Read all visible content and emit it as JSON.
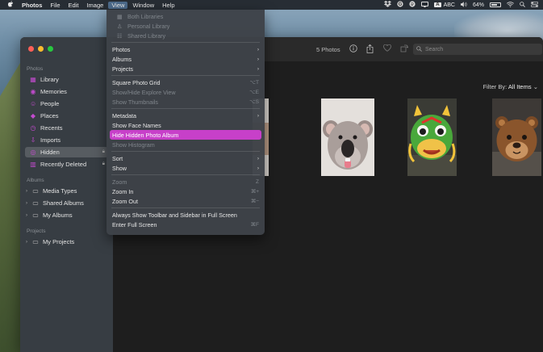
{
  "menubar": {
    "app_name": "Photos",
    "menus": [
      "File",
      "Edit",
      "Image",
      "View",
      "Window",
      "Help"
    ],
    "active_menu": "View",
    "status": {
      "input_source": "ABC",
      "battery": "64%"
    }
  },
  "view_menu": {
    "library_items": [
      {
        "label": "Both Libraries",
        "enabled": false
      },
      {
        "label": "Personal Library",
        "enabled": false
      },
      {
        "label": "Shared Library",
        "enabled": false
      }
    ],
    "group1": [
      {
        "label": "Photos",
        "submenu": true
      },
      {
        "label": "Albums",
        "submenu": true
      },
      {
        "label": "Projects",
        "submenu": true
      }
    ],
    "group2": [
      {
        "label": "Square Photo Grid",
        "shortcut": "⌥T",
        "enabled": true
      },
      {
        "label": "Show/Hide Explore View",
        "shortcut": "⌥E",
        "enabled": false
      },
      {
        "label": "Show Thumbnails",
        "shortcut": "⌥S",
        "enabled": false
      }
    ],
    "group3": [
      {
        "label": "Metadata",
        "submenu": true,
        "enabled": true
      },
      {
        "label": "Show Face Names",
        "enabled": true
      },
      {
        "label": "Hide Hidden Photo Album",
        "enabled": true,
        "highlighted": true
      },
      {
        "label": "Show Histogram",
        "enabled": false
      }
    ],
    "group4": [
      {
        "label": "Sort",
        "submenu": true
      },
      {
        "label": "Show",
        "submenu": true
      }
    ],
    "group5": [
      {
        "label": "Zoom",
        "shortcut": "Z",
        "enabled": false
      },
      {
        "label": "Zoom In",
        "shortcut": "⌘+",
        "enabled": true
      },
      {
        "label": "Zoom Out",
        "shortcut": "⌘−",
        "enabled": true
      }
    ],
    "group6": [
      {
        "label": "Always Show Toolbar and Sidebar in Full Screen"
      },
      {
        "label": "Enter Full Screen",
        "shortcut": "⌘F"
      }
    ]
  },
  "sidebar": {
    "section_photos": "Photos",
    "photos_items": [
      {
        "label": "Library",
        "icon": "library-icon"
      },
      {
        "label": "Memories",
        "icon": "memories-icon"
      },
      {
        "label": "People",
        "icon": "people-icon"
      },
      {
        "label": "Places",
        "icon": "places-icon"
      },
      {
        "label": "Recents",
        "icon": "recents-icon"
      },
      {
        "label": "Imports",
        "icon": "imports-icon"
      },
      {
        "label": "Hidden",
        "icon": "eye-slash-icon",
        "selected": true,
        "locked": true
      },
      {
        "label": "Recently Deleted",
        "icon": "trash-icon",
        "locked": true
      }
    ],
    "section_albums": "Albums",
    "album_items": [
      {
        "label": "Media Types"
      },
      {
        "label": "Shared Albums"
      },
      {
        "label": "My Albums"
      }
    ],
    "section_projects": "Projects",
    "project_items": [
      {
        "label": "My Projects"
      }
    ]
  },
  "toolbar": {
    "photo_count": "5 Photos",
    "search_placeholder": "Search"
  },
  "filter": {
    "label": "Filter By:",
    "value": "All Items"
  },
  "colors": {
    "accent": "#c740c9",
    "sidebar_icon": "#c44bd0"
  }
}
